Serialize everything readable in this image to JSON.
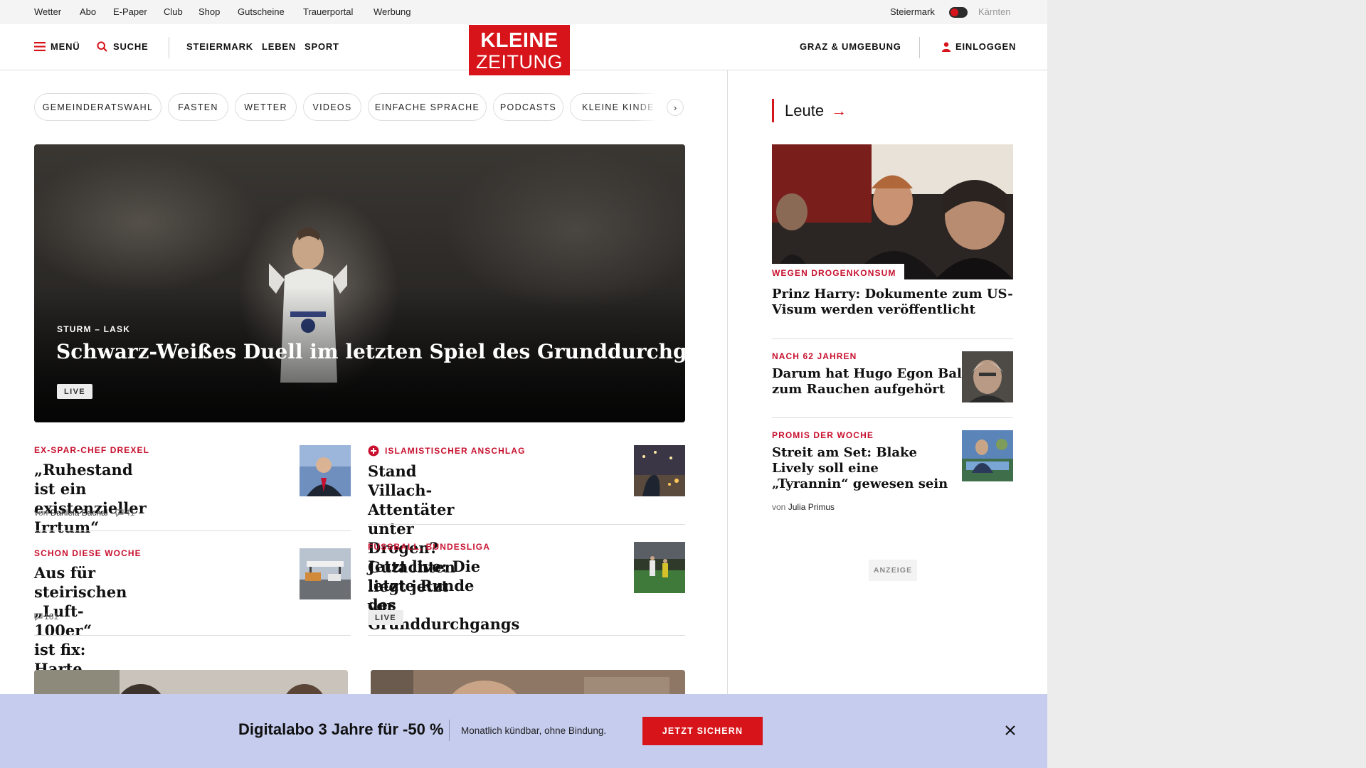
{
  "topbar": {
    "links": [
      "Wetter",
      "Abo",
      "E-Paper",
      "Club",
      "Shop",
      "Gutscheine",
      "Trauerportal",
      "Werbung"
    ],
    "region_left": "Steiermark",
    "region_right": "Kärnten"
  },
  "header": {
    "menu_label": "MENÜ",
    "search_label": "SUCHE",
    "nav": [
      "STEIERMARK",
      "LEBEN",
      "SPORT"
    ],
    "logo_line1": "KLEINE",
    "logo_line2": "ZEITUNG",
    "local_label": "GRAZ & UMGEBUNG",
    "login_label": "EINLOGGEN"
  },
  "chips": [
    "GEMEINDERATSWAHL",
    "FASTEN",
    "WETTER",
    "VIDEOS",
    "EINFACHE SPRACHE",
    "PODCASTS",
    "KLEINE KINDE"
  ],
  "chip_next_glyph": "›",
  "hero": {
    "kicker": "STURM – LASK",
    "title": "Schwarz-Weißes Duell im letzten Spiel des Grunddurchgangs",
    "badge": "LIVE"
  },
  "teasers": [
    {
      "kicker": "EX-SPAR-CHEF DREXEL",
      "title_line1": "„Ruhestand ist ein",
      "title_line2": "existenzieller Irrtum“",
      "author_prefix": "von",
      "author": "Daniela Bachal",
      "comments": "41"
    },
    {
      "kicker": "ISLAMISTISCHER ANSCHLAG",
      "title_line1": "Stand Villach-Attentäter unter",
      "title_line2": "Drogen? Gutachten liegt jetzt vor"
    },
    {
      "kicker": "SCHON DIESE WOCHE",
      "title_line1": "Aus für steirischen „Luft-100er“",
      "title_line2": "ist fix: Harte Kritik von Opposition",
      "comments": "161"
    },
    {
      "kicker": "FUSSBALL, BUNDESLIGA",
      "title_line1": "Jetzt live: Die letzte Runde",
      "title_line2": "des Grunddurchgangs",
      "badge": "LIVE"
    }
  ],
  "sidebar": {
    "heading": "Leute",
    "arrow": "→",
    "items": [
      {
        "kicker": "WEGEN DROGENKONSUM",
        "title_line1": "Prinz Harry: Dokumente zum US-",
        "title_line2": "Visum werden veröffentlicht"
      },
      {
        "kicker": "NACH 62 JAHREN",
        "title_line1": "Darum hat Hugo Egon Balder",
        "title_line2": "zum Rauchen aufgehört"
      },
      {
        "kicker": "PROMIS DER WOCHE",
        "title_line1": "Streit am Set: Blake",
        "title_line2": "Lively soll eine",
        "title_line3": "„Tyrannin“ gewesen sein",
        "author_prefix": "von",
        "author": "Julia Primus"
      }
    ],
    "ad_label": "ANZEIGE"
  },
  "promo": {
    "title": "Digitalabo 3 Jahre für -50 %",
    "subtitle": "Monatlich kündbar, ohne Bindung.",
    "cta": "JETZT SICHERN"
  },
  "colors": {
    "brand_red": "#d7141a",
    "kicker_red": "#c8102e",
    "promo_bg": "#c5ccee"
  }
}
